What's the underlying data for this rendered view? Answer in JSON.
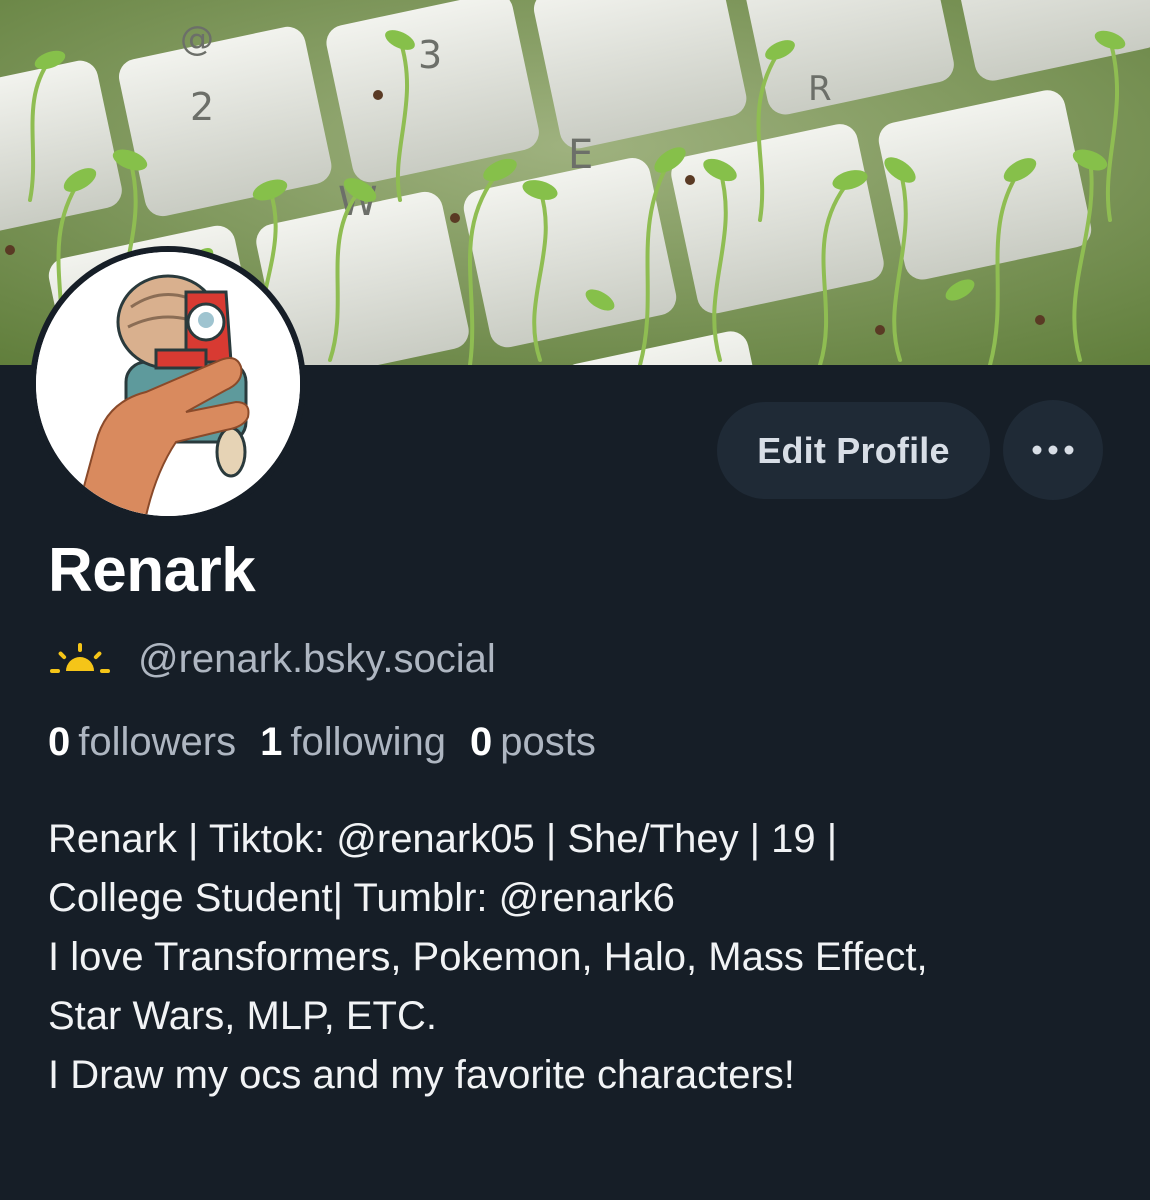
{
  "profile": {
    "name": "Renark",
    "handle": "@renark.bsky.social",
    "stats": {
      "followers_count": "0",
      "followers_label": "followers",
      "following_count": "1",
      "following_label": "following",
      "posts_count": "0",
      "posts_label": "posts"
    },
    "bio_lines": [
      "Renark | Tiktok: @renark05 | She/They | 19 |",
      "College Student| Tumblr: @renark6",
      "I love Transformers, Pokemon, Halo, Mass Effect,",
      "Star Wars, MLP, ETC.",
      "I Draw my ocs and my favorite characters!"
    ]
  },
  "actions": {
    "edit_profile_label": "Edit Profile",
    "more_icon": "ellipsis-icon"
  },
  "banner": {
    "keys": [
      "@",
      "2",
      "3",
      "W",
      "E",
      "R"
    ]
  },
  "colors": {
    "background": "#161e27",
    "button_bg": "#1f2a36",
    "muted_text": "#aeb6c1",
    "accent_yellow": "#f5c518"
  }
}
